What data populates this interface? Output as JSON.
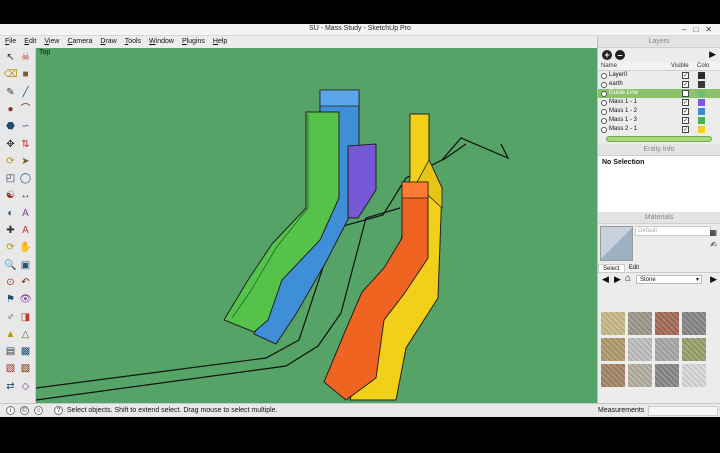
{
  "window": {
    "title": "SU - Mass Study - SketchUp Pro",
    "controls": [
      "minimize",
      "maximize",
      "close"
    ]
  },
  "menu": [
    "File",
    "Edit",
    "View",
    "Camera",
    "Draw",
    "Tools",
    "Window",
    "Plugins",
    "Help"
  ],
  "viewport": {
    "label": "Top",
    "background": "#55a366"
  },
  "toolbar": {
    "icons": [
      "select-icon",
      "paint-bucket-icon",
      "eraser-icon",
      "rectangle-icon",
      "pencil-icon",
      "line-icon",
      "circle-icon",
      "arc-icon",
      "polygon-icon",
      "freehand-icon",
      "move-icon",
      "push-pull-icon",
      "rotate-icon",
      "follow-me-icon",
      "scale-icon",
      "offset-icon",
      "tape-measure-icon",
      "dimension-icon",
      "protractor-icon",
      "text-icon",
      "axes-icon",
      "3d-text-icon",
      "orbit-icon",
      "pan-icon",
      "zoom-icon",
      "zoom-window-icon",
      "zoom-extents-icon",
      "previous-view-icon",
      "position-camera-icon",
      "look-around-icon",
      "walk-icon",
      "section-plane-icon",
      "sandbox-from-contours-icon",
      "sandbox-from-scratch-icon",
      "smoove-icon",
      "stamp-icon",
      "drape-icon",
      "add-detail-icon",
      "flip-edge-icon",
      "soften-icon"
    ]
  },
  "layers": {
    "title": "Layers",
    "columns": {
      "name": "Name",
      "visible": "Visible",
      "color": "Colo"
    },
    "rows": [
      {
        "name": "Layer0",
        "visible": true,
        "color": "#2b2b2b",
        "selected": false
      },
      {
        "name": "earth",
        "visible": true,
        "color": "#3a3a3a",
        "selected": false
      },
      {
        "name": "Guide Line",
        "visible": false,
        "color": "#6fbf73",
        "selected": true
      },
      {
        "name": "Mass 1 - 1",
        "visible": true,
        "color": "#7c5cd6",
        "selected": false
      },
      {
        "name": "Mass 1 - 2",
        "visible": true,
        "color": "#3f88d0",
        "selected": false
      },
      {
        "name": "Mass 1 - 3",
        "visible": true,
        "color": "#4caf50",
        "selected": false
      },
      {
        "name": "Mass 2 - 1",
        "visible": true,
        "color": "#f0d21b",
        "selected": false
      }
    ]
  },
  "entity_info": {
    "title": "Entity Info",
    "selection": "No Selection"
  },
  "materials": {
    "title": "Materials",
    "name_placeholder": "Default",
    "tabs": [
      "Select",
      "Edit"
    ],
    "collection": "Stone",
    "swatches": [
      "#c9b98a",
      "#9c9a8c",
      "#a56a58",
      "#8a8886",
      "#b09b6c",
      "#bfbfbf",
      "#a8a8a8",
      "#9aa06b",
      "#a58566",
      "#b4b0a0",
      "#888888",
      "#d8d8d8"
    ]
  },
  "status": {
    "message": "Select objects. Shift to extend select. Drag mouse to select multiple.",
    "measurements_label": "Measurements"
  }
}
